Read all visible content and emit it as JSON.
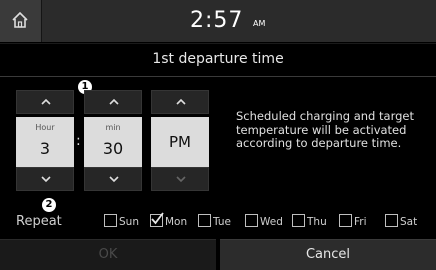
{
  "status": {
    "time": "2:57",
    "ampm": "AM"
  },
  "title": "1st departure time",
  "callouts": {
    "one": "1",
    "two": "2"
  },
  "hour": {
    "unit": "Hour",
    "value": "3"
  },
  "minute": {
    "unit": "min",
    "value": "30"
  },
  "ampm_value": "PM",
  "separator": ":",
  "info_text": "Scheduled charging and target temperature will be activated according to departure time.",
  "repeat": {
    "label": "Repeat",
    "days": [
      {
        "label": "Sun",
        "checked": false
      },
      {
        "label": "Mon",
        "checked": true
      },
      {
        "label": "Tue",
        "checked": false
      },
      {
        "label": "Wed",
        "checked": false
      },
      {
        "label": "Thu",
        "checked": false
      },
      {
        "label": "Fri",
        "checked": false
      },
      {
        "label": "Sat",
        "checked": false
      }
    ]
  },
  "buttons": {
    "ok": "OK",
    "cancel": "Cancel"
  }
}
